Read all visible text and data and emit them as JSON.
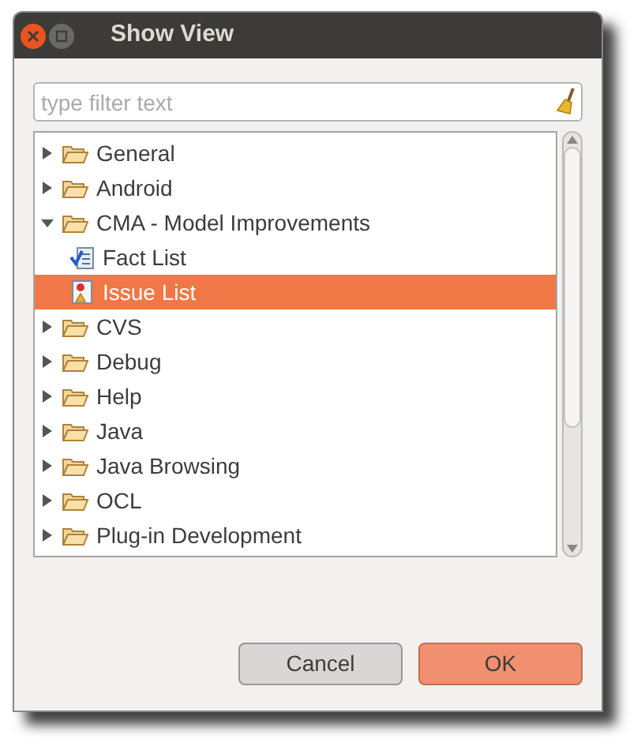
{
  "window": {
    "title": "Show View"
  },
  "filter": {
    "placeholder": "type filter text"
  },
  "tree": [
    {
      "label": "General",
      "kind": "folder",
      "expanded": false,
      "selected": false
    },
    {
      "label": "Android",
      "kind": "folder",
      "expanded": false,
      "selected": false
    },
    {
      "label": "CMA - Model Improvements",
      "kind": "folder",
      "expanded": true,
      "selected": false,
      "children": [
        {
          "label": "Fact List",
          "kind": "checklist",
          "selected": false
        },
        {
          "label": "Issue List",
          "kind": "issues",
          "selected": true
        }
      ]
    },
    {
      "label": "CVS",
      "kind": "folder",
      "expanded": false,
      "selected": false
    },
    {
      "label": "Debug",
      "kind": "folder",
      "expanded": false,
      "selected": false
    },
    {
      "label": "Help",
      "kind": "folder",
      "expanded": false,
      "selected": false
    },
    {
      "label": "Java",
      "kind": "folder",
      "expanded": false,
      "selected": false
    },
    {
      "label": "Java Browsing",
      "kind": "folder",
      "expanded": false,
      "selected": false
    },
    {
      "label": "OCL",
      "kind": "folder",
      "expanded": false,
      "selected": false
    },
    {
      "label": "Plug-in Development",
      "kind": "folder",
      "expanded": false,
      "selected": false
    }
  ],
  "buttons": [
    {
      "label": "Cancel",
      "kind": "secondary"
    },
    {
      "label": "OK",
      "kind": "primary"
    }
  ]
}
